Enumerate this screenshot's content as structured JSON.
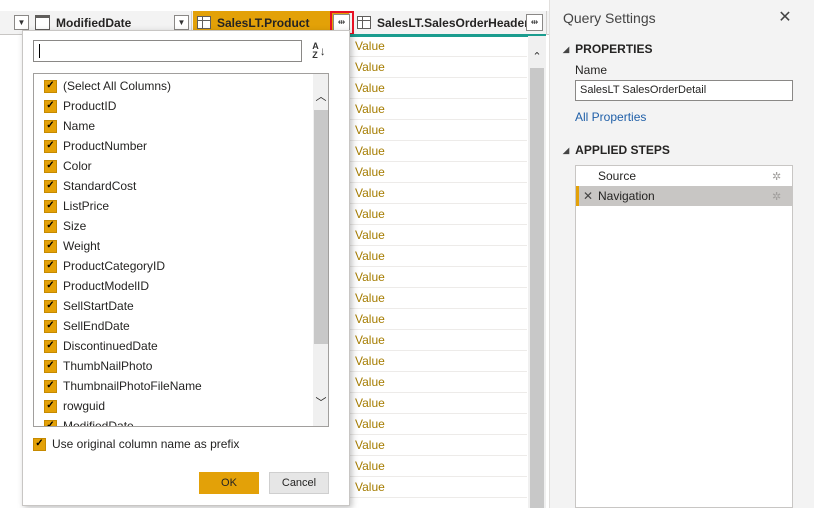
{
  "grid": {
    "columns": [
      {
        "label": "ModifiedDate"
      },
      {
        "label": "SalesLT.Product"
      },
      {
        "label": "SalesLT.SalesOrderHeader"
      }
    ],
    "value_text": "Value",
    "row_count": 22
  },
  "popup": {
    "search_value": "",
    "sort_icon": "sort-az-icon",
    "items": [
      {
        "label": "(Select All Columns)",
        "checked": true
      },
      {
        "label": "ProductID",
        "checked": true
      },
      {
        "label": "Name",
        "checked": true
      },
      {
        "label": "ProductNumber",
        "checked": true
      },
      {
        "label": "Color",
        "checked": true
      },
      {
        "label": "StandardCost",
        "checked": true
      },
      {
        "label": "ListPrice",
        "checked": true
      },
      {
        "label": "Size",
        "checked": true
      },
      {
        "label": "Weight",
        "checked": true
      },
      {
        "label": "ProductCategoryID",
        "checked": true
      },
      {
        "label": "ProductModelID",
        "checked": true
      },
      {
        "label": "SellStartDate",
        "checked": true
      },
      {
        "label": "SellEndDate",
        "checked": true
      },
      {
        "label": "DiscontinuedDate",
        "checked": true
      },
      {
        "label": "ThumbNailPhoto",
        "checked": true
      },
      {
        "label": "ThumbnailPhotoFileName",
        "checked": true
      },
      {
        "label": "rowguid",
        "checked": true
      },
      {
        "label": "ModifiedDate",
        "checked": true
      }
    ],
    "prefix_label": "Use original column name as prefix",
    "ok_label": "OK",
    "cancel_label": "Cancel"
  },
  "query_settings": {
    "title": "Query Settings",
    "properties_heading": "PROPERTIES",
    "name_label": "Name",
    "name_value": "SalesLT SalesOrderDetail",
    "all_properties_link": "All Properties",
    "applied_steps_heading": "APPLIED STEPS",
    "steps": [
      {
        "label": "Source"
      },
      {
        "label": "Navigation"
      }
    ]
  },
  "colors": {
    "accent": "#e3a108",
    "value_text": "#a57c00",
    "link": "#1f5fa8",
    "teal": "#1a9c8e"
  }
}
